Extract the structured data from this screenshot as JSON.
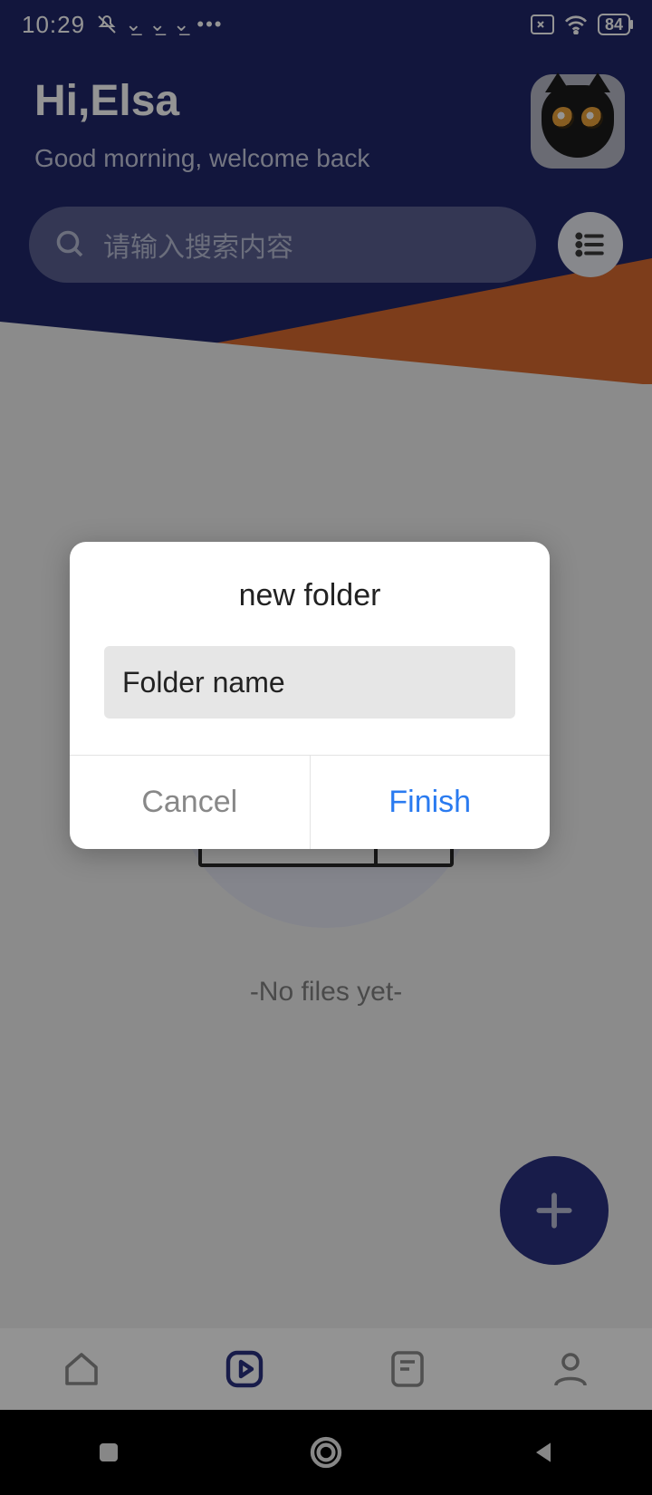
{
  "status": {
    "time": "10:29",
    "battery": "84"
  },
  "header": {
    "greeting_title": "Hi,Elsa",
    "greeting_sub": "Good morning, welcome back",
    "search_placeholder": "请输入搜索内容"
  },
  "empty": {
    "text": "-No files yet-"
  },
  "dialog": {
    "title": "new folder",
    "placeholder": "Folder name",
    "cancel": "Cancel",
    "finish": "Finish"
  }
}
